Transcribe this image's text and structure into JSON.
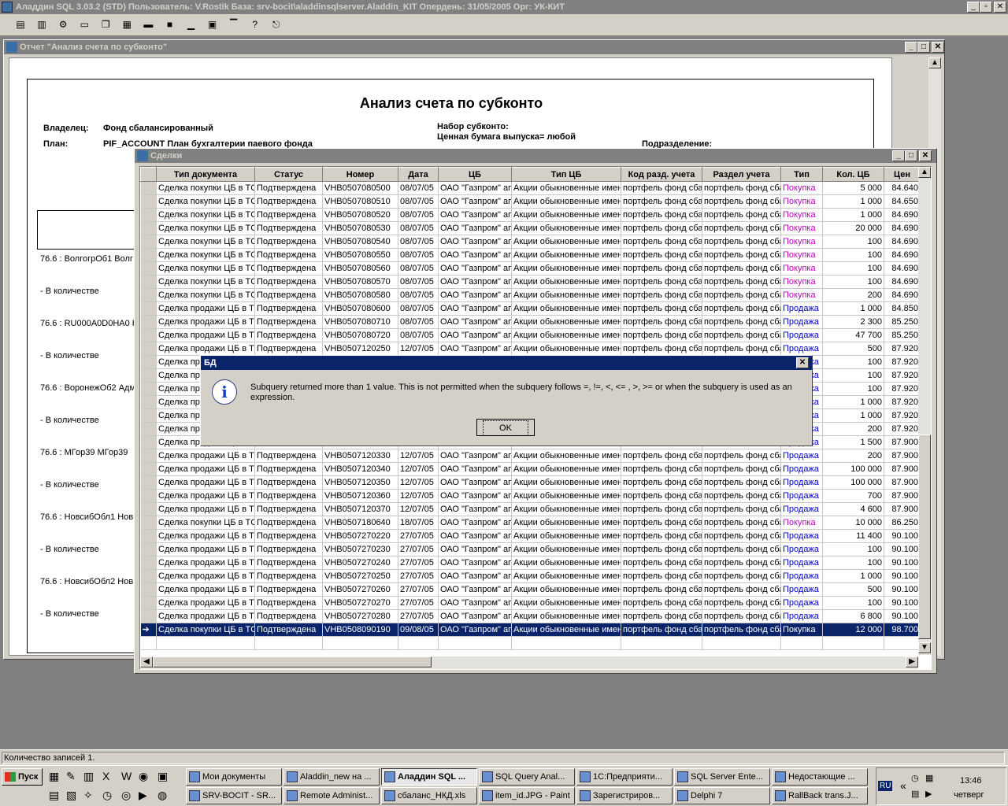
{
  "app_title": "Аладдин SQL 3.03.2 (STD)  Пользователь: V.Rostik База: srv-bocit\\aladdinsqlserver.Aladdin_KIT Опердень: 31/05/2005 Орг: УК-КИТ",
  "report": {
    "window_title": "Отчет \"Анализ счета по субконто\"",
    "heading": "Анализ счета по субконто",
    "owner_label": "Владелец:",
    "owner_value": "Фонд сбалансированный",
    "plan_label": "План:",
    "plan_value": "PIF_ACCOUNT План бухгалтерии паевого фонда",
    "subconto_set_label": "Набор субконто:",
    "security_line": "Ценная бумага выпуска= любой",
    "division_label": "Подразделение:",
    "lines": [
      "76.6 : ВолгогрОб1 Волг",
      "- В количестве",
      "76.6 : RU000A0D0HA0 К",
      "- В количестве",
      "76.6 : ВоронежОб2 Адм",
      "- В количестве",
      "76.6 : МГор39 МГор39",
      "- В количестве",
      "76.6 : НовсибОбл1 Нов",
      "- В количестве",
      "76.6 : НовсибОбл2 Нов",
      "- В количестве"
    ]
  },
  "deals": {
    "window_title": "Сделки",
    "columns": [
      "Тип документа",
      "Статус",
      "Номер",
      "Дата",
      "ЦБ",
      "Тип ЦБ",
      "Код разд. учета",
      "Раздел учета",
      "Тип",
      "Кол. ЦБ",
      "Цен"
    ],
    "rows": [
      [
        "Сделка покупки ЦБ в ТС",
        "Подтверждена",
        "VHB0507080500",
        "08/07/05",
        "ОАО \"Газпром\" ап",
        "Акции обыкновенные имен",
        "портфель фонд сба",
        "портфель фонд сба",
        "Покупка",
        "5 000",
        "84.640"
      ],
      [
        "Сделка покупки ЦБ в ТС",
        "Подтверждена",
        "VHB0507080510",
        "08/07/05",
        "ОАО \"Газпром\" ап",
        "Акции обыкновенные имен",
        "портфель фонд сба",
        "портфель фонд сба",
        "Покупка",
        "1 000",
        "84.650"
      ],
      [
        "Сделка покупки ЦБ в ТС",
        "Подтверждена",
        "VHB0507080520",
        "08/07/05",
        "ОАО \"Газпром\" ап",
        "Акции обыкновенные имен",
        "портфель фонд сба",
        "портфель фонд сба",
        "Покупка",
        "1 000",
        "84.690"
      ],
      [
        "Сделка покупки ЦБ в ТС",
        "Подтверждена",
        "VHB0507080530",
        "08/07/05",
        "ОАО \"Газпром\" ап",
        "Акции обыкновенные имен",
        "портфель фонд сба",
        "портфель фонд сба",
        "Покупка",
        "20 000",
        "84.690"
      ],
      [
        "Сделка покупки ЦБ в ТС",
        "Подтверждена",
        "VHB0507080540",
        "08/07/05",
        "ОАО \"Газпром\" ап",
        "Акции обыкновенные имен",
        "портфель фонд сба",
        "портфель фонд сба",
        "Покупка",
        "100",
        "84.690"
      ],
      [
        "Сделка покупки ЦБ в ТС",
        "Подтверждена",
        "VHB0507080550",
        "08/07/05",
        "ОАО \"Газпром\" ап",
        "Акции обыкновенные имен",
        "портфель фонд сба",
        "портфель фонд сба",
        "Покупка",
        "100",
        "84.690"
      ],
      [
        "Сделка покупки ЦБ в ТС",
        "Подтверждена",
        "VHB0507080560",
        "08/07/05",
        "ОАО \"Газпром\" ап",
        "Акции обыкновенные имен",
        "портфель фонд сба",
        "портфель фонд сба",
        "Покупка",
        "100",
        "84.690"
      ],
      [
        "Сделка покупки ЦБ в ТС",
        "Подтверждена",
        "VHB0507080570",
        "08/07/05",
        "ОАО \"Газпром\" ап",
        "Акции обыкновенные имен",
        "портфель фонд сба",
        "портфель фонд сба",
        "Покупка",
        "100",
        "84.690"
      ],
      [
        "Сделка покупки ЦБ в ТС",
        "Подтверждена",
        "VHB0507080580",
        "08/07/05",
        "ОАО \"Газпром\" ап",
        "Акции обыкновенные имен",
        "портфель фонд сба",
        "портфель фонд сба",
        "Покупка",
        "200",
        "84.690"
      ],
      [
        "Сделка продажи ЦБ в ТС",
        "Подтверждена",
        "VHB0507080600",
        "08/07/05",
        "ОАО \"Газпром\" ап",
        "Акции обыкновенные имен",
        "портфель фонд сба",
        "портфель фонд сба",
        "Продажа",
        "1 000",
        "84.850"
      ],
      [
        "Сделка продажи ЦБ в ТС",
        "Подтверждена",
        "VHB0507080710",
        "08/07/05",
        "ОАО \"Газпром\" ап",
        "Акции обыкновенные имен",
        "портфель фонд сба",
        "портфель фонд сба",
        "Продажа",
        "2 300",
        "85.250"
      ],
      [
        "Сделка продажи ЦБ в ТС",
        "Подтверждена",
        "VHB0507080720",
        "08/07/05",
        "ОАО \"Газпром\" ап",
        "Акции обыкновенные имен",
        "портфель фонд сба",
        "портфель фонд сба",
        "Продажа",
        "47 700",
        "85.250"
      ],
      [
        "Сделка продажи ЦБ в ТС",
        "Подтверждена",
        "VHB0507120250",
        "12/07/05",
        "ОАО \"Газпром\" ап",
        "Акции обыкновенные имен",
        "портфель фонд сба",
        "портфель фонд сба",
        "Продажа",
        "500",
        "87.920"
      ],
      [
        "Сделка продажи ЦБ в ТС",
        "",
        "",
        "",
        "",
        "",
        "",
        "",
        "Продажа",
        "100",
        "87.920"
      ],
      [
        "Сделка продажи ЦБ в ТС",
        "",
        "",
        "",
        "",
        "",
        "",
        "",
        "Продажа",
        "100",
        "87.920"
      ],
      [
        "Сделка продажи ЦБ в ТС",
        "",
        "",
        "",
        "",
        "",
        "",
        "",
        "Продажа",
        "100",
        "87.920"
      ],
      [
        "Сделка продажи ЦБ в ТС",
        "",
        "",
        "",
        "",
        "",
        "",
        "",
        "Продажа",
        "1 000",
        "87.920"
      ],
      [
        "Сделка продажи ЦБ в ТС",
        "",
        "",
        "",
        "",
        "",
        "",
        "",
        "Продажа",
        "1 000",
        "87.920"
      ],
      [
        "Сделка продажи ЦБ в ТС",
        "",
        "",
        "",
        "",
        "",
        "",
        "",
        "Продажа",
        "200",
        "87.920"
      ],
      [
        "Сделка продажи ЦБ в ТС",
        "",
        "",
        "",
        "",
        "",
        "",
        "",
        "Продажа",
        "1 500",
        "87.900"
      ],
      [
        "Сделка продажи ЦБ в ТС",
        "Подтверждена",
        "VHB0507120330",
        "12/07/05",
        "ОАО \"Газпром\" ап",
        "Акции обыкновенные имен",
        "портфель фонд сба",
        "портфель фонд сба",
        "Продажа",
        "200",
        "87.900"
      ],
      [
        "Сделка продажи ЦБ в ТС",
        "Подтверждена",
        "VHB0507120340",
        "12/07/05",
        "ОАО \"Газпром\" ап",
        "Акции обыкновенные имен",
        "портфель фонд сба",
        "портфель фонд сба",
        "Продажа",
        "100 000",
        "87.900"
      ],
      [
        "Сделка продажи ЦБ в ТС",
        "Подтверждена",
        "VHB0507120350",
        "12/07/05",
        "ОАО \"Газпром\" ап",
        "Акции обыкновенные имен",
        "портфель фонд сба",
        "портфель фонд сба",
        "Продажа",
        "100 000",
        "87.900"
      ],
      [
        "Сделка продажи ЦБ в ТС",
        "Подтверждена",
        "VHB0507120360",
        "12/07/05",
        "ОАО \"Газпром\" ап",
        "Акции обыкновенные имен",
        "портфель фонд сба",
        "портфель фонд сба",
        "Продажа",
        "700",
        "87.900"
      ],
      [
        "Сделка продажи ЦБ в ТС",
        "Подтверждена",
        "VHB0507120370",
        "12/07/05",
        "ОАО \"Газпром\" ап",
        "Акции обыкновенные имен",
        "портфель фонд сба",
        "портфель фонд сба",
        "Продажа",
        "4 600",
        "87.900"
      ],
      [
        "Сделка покупки ЦБ в ТС",
        "Подтверждена",
        "VHB0507180640",
        "18/07/05",
        "ОАО \"Газпром\" ап",
        "Акции обыкновенные имен",
        "портфель фонд сба",
        "портфель фонд сба",
        "Покупка",
        "10 000",
        "86.250"
      ],
      [
        "Сделка продажи ЦБ в ТС",
        "Подтверждена",
        "VHB0507270220",
        "27/07/05",
        "ОАО \"Газпром\" ап",
        "Акции обыкновенные имен",
        "портфель фонд сба",
        "портфель фонд сба",
        "Продажа",
        "11 400",
        "90.100"
      ],
      [
        "Сделка продажи ЦБ в ТС",
        "Подтверждена",
        "VHB0507270230",
        "27/07/05",
        "ОАО \"Газпром\" ап",
        "Акции обыкновенные имен",
        "портфель фонд сба",
        "портфель фонд сба",
        "Продажа",
        "100",
        "90.100"
      ],
      [
        "Сделка продажи ЦБ в ТС",
        "Подтверждена",
        "VHB0507270240",
        "27/07/05",
        "ОАО \"Газпром\" ап",
        "Акции обыкновенные имен",
        "портфель фонд сба",
        "портфель фонд сба",
        "Продажа",
        "100",
        "90.100"
      ],
      [
        "Сделка продажи ЦБ в ТС",
        "Подтверждена",
        "VHB0507270250",
        "27/07/05",
        "ОАО \"Газпром\" ап",
        "Акции обыкновенные имен",
        "портфель фонд сба",
        "портфель фонд сба",
        "Продажа",
        "1 000",
        "90.100"
      ],
      [
        "Сделка продажи ЦБ в ТС",
        "Подтверждена",
        "VHB0507270260",
        "27/07/05",
        "ОАО \"Газпром\" ап",
        "Акции обыкновенные имен",
        "портфель фонд сба",
        "портфель фонд сба",
        "Продажа",
        "500",
        "90.100"
      ],
      [
        "Сделка продажи ЦБ в ТС",
        "Подтверждена",
        "VHB0507270270",
        "27/07/05",
        "ОАО \"Газпром\" ап",
        "Акции обыкновенные имен",
        "портфель фонд сба",
        "портфель фонд сба",
        "Продажа",
        "100",
        "90.100"
      ],
      [
        "Сделка продажи ЦБ в ТС",
        "Подтверждена",
        "VHB0507270280",
        "27/07/05",
        "ОАО \"Газпром\" ап",
        "Акции обыкновенные имен",
        "портфель фонд сба",
        "портфель фонд сба",
        "Продажа",
        "6 800",
        "90.100"
      ],
      [
        "Сделка покупки ЦБ в ТС",
        "Подтверждена",
        "VHB0508090190",
        "09/08/05",
        "ОАО \"Газпром\" ап",
        "Акции обыкновенные имен",
        "портфель фонд сба",
        "портфель фонд сба",
        "Покупка",
        "12 000",
        "98.700"
      ]
    ],
    "selected_row": 33
  },
  "dialog": {
    "title": "БД",
    "message": "Subquery returned more than 1 value. This is not permitted when the subquery follows =, !=, <, <= , >, >= or when the subquery is used as an expression.",
    "ok_label": "OK"
  },
  "status_bar": "Количество записей 1.",
  "taskbar": {
    "start_label": "Пуск",
    "row1": [
      "Мои документы",
      "Aladdin_new на ...",
      "Аладдин SQL ...",
      "SQL Query Anal...",
      "1С:Предприяти...",
      "SQL Server Ente...",
      "Недостающие ..."
    ],
    "row2": [
      "SRV-BOCIT - SR...",
      "Remote Administ...",
      "сбаланс_НКД.xls",
      "item_id.JPG - Paint",
      "Зарегистриров...",
      "Delphi 7",
      "RallBack trans.J..."
    ],
    "lang": "RU",
    "time": "13:46",
    "day": "четверг"
  }
}
